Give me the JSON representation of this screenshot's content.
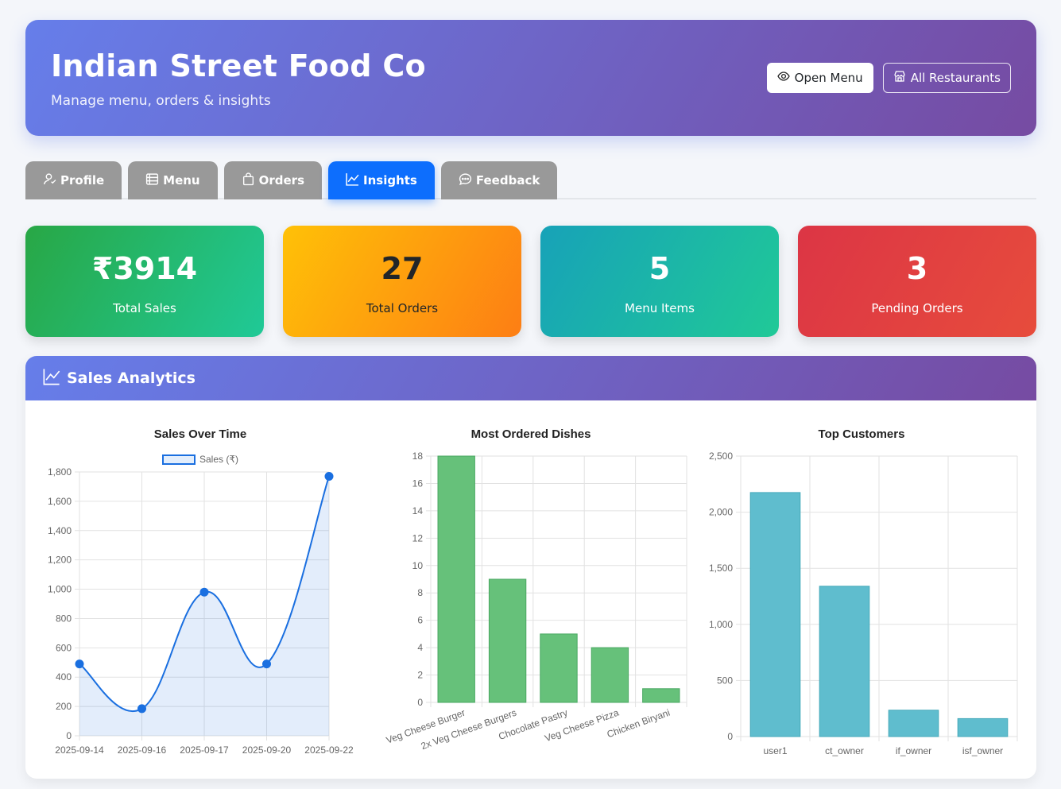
{
  "header": {
    "title": "Indian Street Food Co",
    "subtitle": "Manage menu, orders & insights",
    "open_menu_label": "Open Menu",
    "all_restaurants_label": "All Restaurants"
  },
  "tabs": [
    {
      "label": "Profile",
      "icon": "user-icon",
      "active": false
    },
    {
      "label": "Menu",
      "icon": "menu-list-icon",
      "active": false
    },
    {
      "label": "Orders",
      "icon": "bag-icon",
      "active": false
    },
    {
      "label": "Insights",
      "icon": "graph-icon",
      "active": true
    },
    {
      "label": "Feedback",
      "icon": "chat-icon",
      "active": false
    }
  ],
  "stats": [
    {
      "value": "₹3914",
      "label": "Total Sales"
    },
    {
      "value": "27",
      "label": "Total Orders"
    },
    {
      "value": "5",
      "label": "Menu Items"
    },
    {
      "value": "3",
      "label": "Pending Orders"
    }
  ],
  "analytics": {
    "title": "Sales Analytics"
  },
  "colors": {
    "header_gradient": [
      "#667eea",
      "#764ba2"
    ],
    "active_tab": "#0d6efd",
    "line": "#1a6fe0",
    "bars_dishes": "#66c17a",
    "bars_customers": "#5fbdce"
  },
  "chart_data": [
    {
      "type": "line",
      "title": "Sales Over Time",
      "x": [
        "2025-09-14",
        "2025-09-16",
        "2025-09-17",
        "2025-09-20",
        "2025-09-22"
      ],
      "series": [
        {
          "name": "Sales (₹)",
          "values": [
            490,
            185,
            980,
            490,
            1770
          ]
        }
      ],
      "ylim": [
        0,
        1800
      ],
      "yticks": [
        "0",
        "200",
        "400",
        "600",
        "800",
        "1,000",
        "1,200",
        "1,400",
        "1,600",
        "1,800"
      ],
      "grid": true,
      "legend": "top"
    },
    {
      "type": "bar",
      "title": "Most Ordered Dishes",
      "categories": [
        "Veg Cheese Burger",
        "2x Veg Cheese Burgers",
        "Chocolate Pastry",
        "Veg Cheese Pizza",
        "Chicken Biryani"
      ],
      "values": [
        18,
        9,
        5,
        4,
        1
      ],
      "ylim": [
        0,
        18
      ],
      "yticks": [
        "0",
        "2",
        "4",
        "6",
        "8",
        "10",
        "12",
        "14",
        "16",
        "18"
      ],
      "grid": true
    },
    {
      "type": "bar",
      "title": "Top Customers",
      "categories": [
        "user1",
        "ct_owner",
        "if_owner",
        "isf_owner"
      ],
      "values": [
        2175,
        1340,
        235,
        160
      ],
      "ylim": [
        0,
        2500
      ],
      "yticks": [
        "0",
        "500",
        "1,000",
        "1,500",
        "2,000",
        "2,500"
      ],
      "grid": true
    }
  ]
}
